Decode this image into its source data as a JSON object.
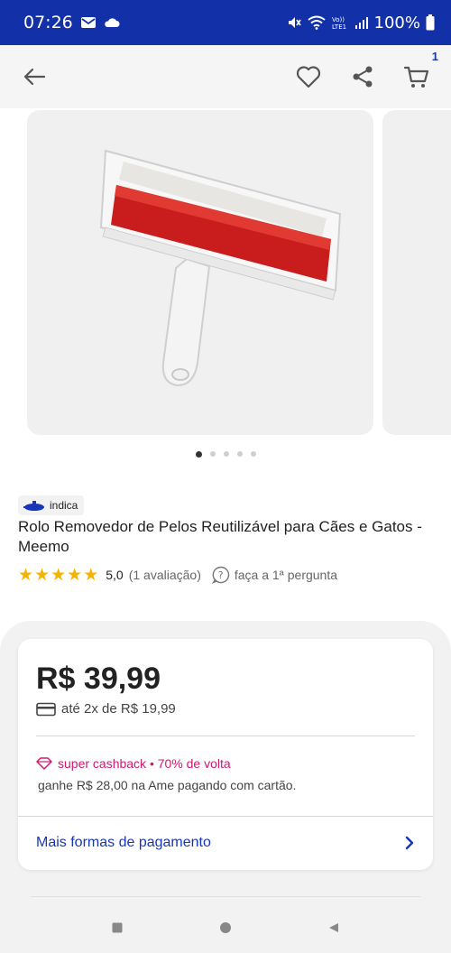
{
  "status_bar": {
    "time": "07:26",
    "battery": "100%",
    "icons": [
      "email-icon",
      "cloud-icon",
      "mute-icon",
      "wifi-icon",
      "volte-icon",
      "signal-icon",
      "battery-icon"
    ]
  },
  "header": {
    "back_icon": "arrow-left-icon",
    "favorite_icon": "heart-icon",
    "share_icon": "share-icon",
    "cart_icon": "cart-icon",
    "cart_count": "1"
  },
  "gallery": {
    "image_alt": "lint-roller-image",
    "slide_count": 5,
    "active_index": 0
  },
  "product": {
    "badge_label": "indica",
    "title": "Rolo Removedor de Pelos Reutilizável para Cães e Gatos - Meemo",
    "rating_score": "5,0",
    "rating_stars": 5,
    "reviews_text": "(1 avaliação)",
    "question_text": "faça a 1ª pergunta"
  },
  "price": {
    "amount": "R$ 39,99",
    "installments": "até 2x de R$ 19,99",
    "cashback": "super cashback • 70% de volta",
    "ame_text": "ganhe R$ 28,00 na Ame pagando com cartão.",
    "more_payments": "Mais formas de pagamento"
  },
  "colors": {
    "status_bar": "#1231a8",
    "link_blue": "#1836b8",
    "cashback_pink": "#d3186e",
    "star_yellow": "#f4b400"
  },
  "nav": {
    "icons": [
      "recents-icon",
      "home-icon",
      "back-icon"
    ]
  }
}
